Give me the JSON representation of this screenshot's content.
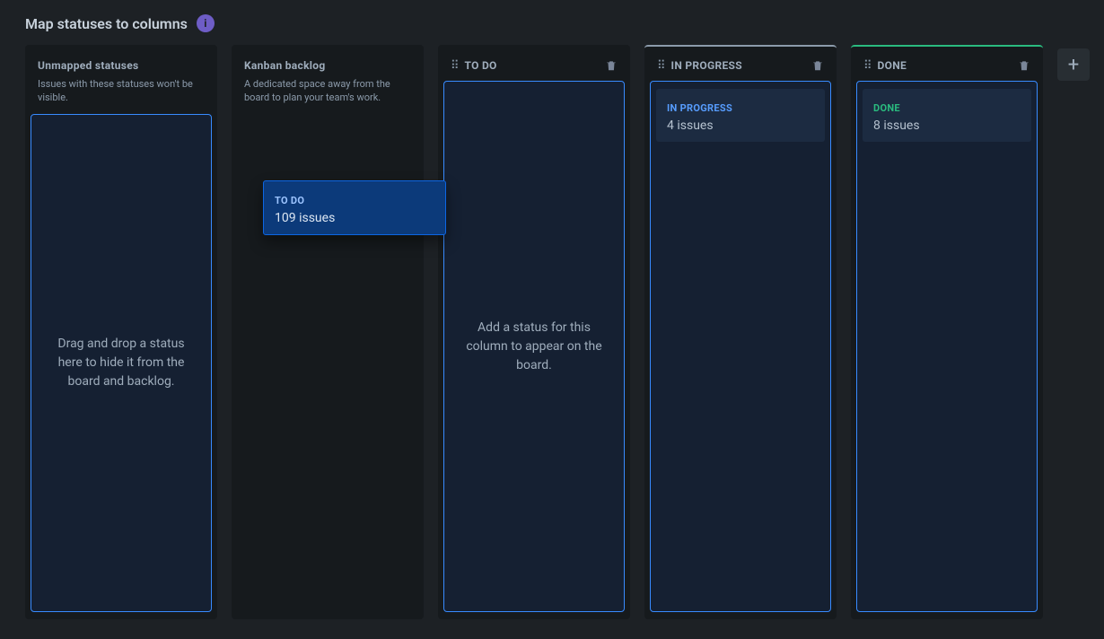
{
  "header": {
    "title": "Map statuses to columns"
  },
  "columns": {
    "unmapped": {
      "title": "Unmapped statuses",
      "description": "Issues with these statuses won't be visible.",
      "dropzone_text": "Drag and drop a status here to hide it from the board and backlog."
    },
    "backlog": {
      "title": "Kanban backlog",
      "description": "A dedicated space away from the board to plan your team's work."
    },
    "todo": {
      "title": "TO DO",
      "dropzone_text": "Add a status for this column to appear on the board."
    },
    "inprogress": {
      "title": "IN PROGRESS",
      "status_label": "IN PROGRESS",
      "status_count": "4 issues"
    },
    "done": {
      "title": "DONE",
      "status_label": "DONE",
      "status_count": "8 issues"
    }
  },
  "dragging": {
    "status_label": "TO DO",
    "status_count": "109 issues"
  }
}
